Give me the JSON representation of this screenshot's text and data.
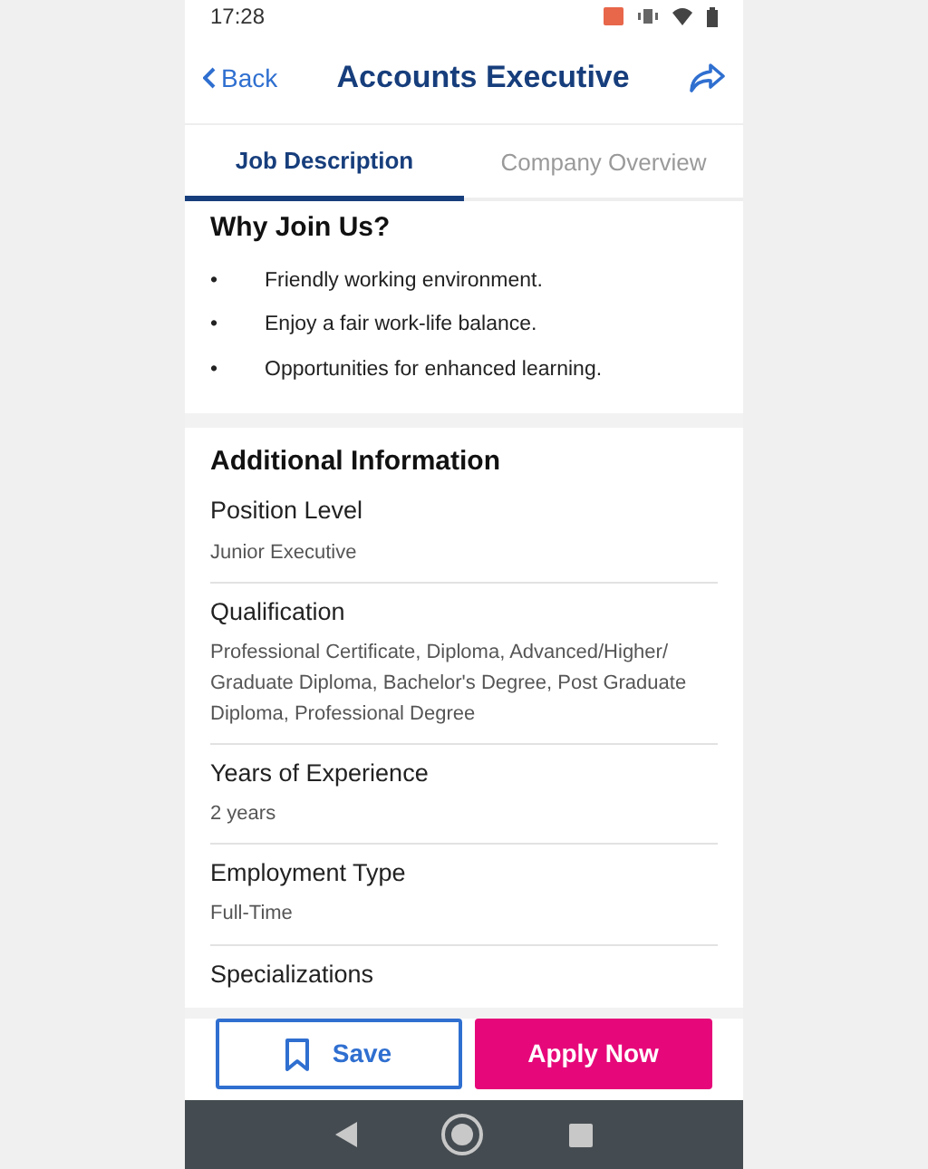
{
  "status_bar": {
    "time": "17:28"
  },
  "header": {
    "back": "Back",
    "title": "Accounts Executive"
  },
  "tabs": [
    {
      "label": "Job Description",
      "selected": true
    },
    {
      "label": "Company Overview",
      "selected": false
    }
  ],
  "why_join": {
    "heading": "Why Join Us?",
    "bullets": [
      {
        "marker": "•",
        "text": "Friendly working environment."
      },
      {
        "marker": "•",
        "text": "Enjoy a fair work-life balance."
      },
      {
        "marker": "•",
        "text": "Opportunities for enhanced learning."
      }
    ]
  },
  "additional_information": {
    "heading": "Additional Information",
    "fields": [
      {
        "label": "Position Level",
        "value": "Junior Executive"
      },
      {
        "label": "Qualification",
        "value": "Professional Certificate, Diploma, Advanced/Higher/ Graduate Diploma, Bachelor's Degree, Post Graduate Diploma, Professional Degree"
      },
      {
        "label": "Years of Experience",
        "value": "2 years"
      },
      {
        "label": "Employment Type",
        "value": "Full-Time"
      },
      {
        "label": "Specializations"
      }
    ]
  },
  "actions": {
    "save": "Save",
    "apply": "Apply Now"
  }
}
